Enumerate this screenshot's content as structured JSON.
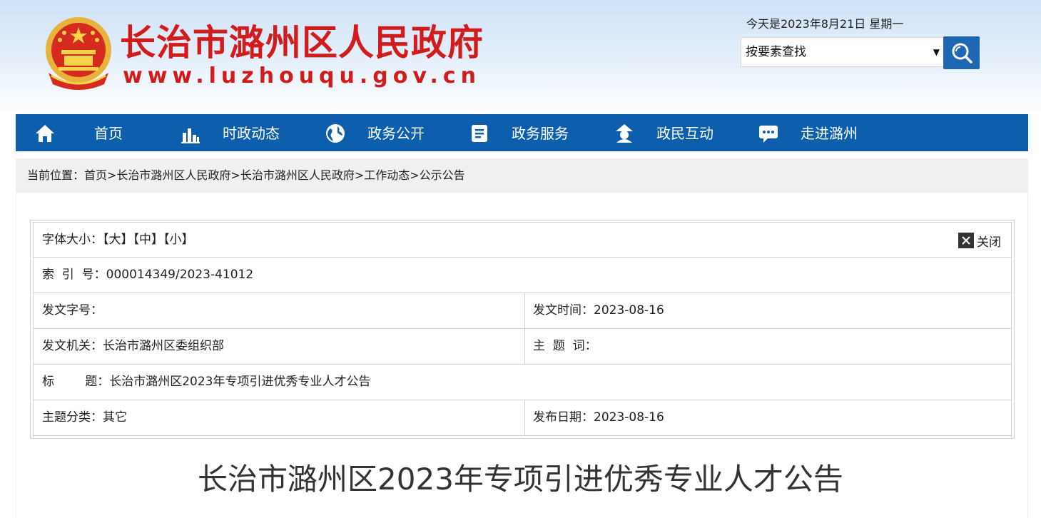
{
  "header": {
    "site_title": "长治市潞州区人民政府",
    "site_url": "www.luzhouqu.gov.cn",
    "date_text": "今天是2023年8月21日 星期一",
    "search_select_value": "按要素查找",
    "brand_color": "#d21c1c"
  },
  "nav": {
    "items": [
      {
        "label": "首页",
        "icon": "home-icon"
      },
      {
        "label": "时政动态",
        "icon": "bar-chart-icon"
      },
      {
        "label": "政务公开",
        "icon": "globe-icon"
      },
      {
        "label": "政务服务",
        "icon": "document-icon"
      },
      {
        "label": "政民互动",
        "icon": "people-icon"
      },
      {
        "label": "走进潞州",
        "icon": "chat-icon"
      }
    ],
    "bg_color": "#0d5fae"
  },
  "breadcrumb": {
    "text": "当前位置：首页>长治市潞州区人民政府>长治市潞州区人民政府>工作动态>公示公告"
  },
  "info": {
    "font_size_label": "字体大小：",
    "font_large": "【大】",
    "font_medium": "【中】",
    "font_small": "【小】",
    "close_label": "关闭",
    "index_label": "索  引  号：",
    "index_value": "000014349/2023-41012",
    "doc_no_label": "发文字号：",
    "doc_no_value": "",
    "issue_time_label": "发文时间：",
    "issue_time_value": "2023-08-16",
    "issuer_label": "发文机关：",
    "issuer_value": "长治市潞州区委组织部",
    "keywords_label": "主  题  词：",
    "keywords_value": "",
    "title_label": "标        题：",
    "title_value": "长治市潞州区2023年专项引进优秀专业人才公告",
    "category_label": "主题分类：",
    "category_value": "其它",
    "publish_date_label": "发布日期：",
    "publish_date_value": "2023-08-16"
  },
  "article": {
    "title": "长治市潞州区2023年专项引进优秀专业人才公告"
  }
}
